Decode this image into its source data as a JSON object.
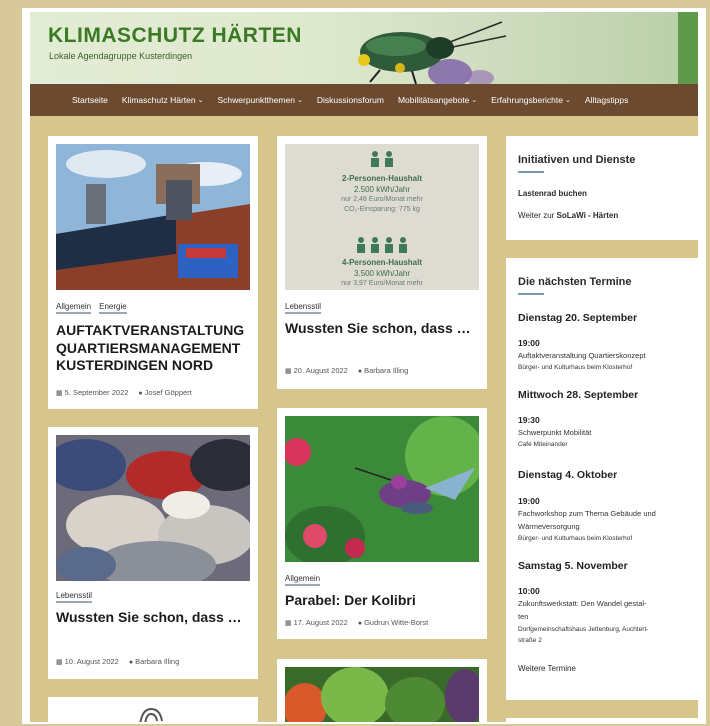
{
  "site": {
    "title": "KLIMASCHUTZ HÄRTEN",
    "subtitle": "Lokale Agendagruppe Kusterdingen"
  },
  "nav": [
    {
      "label": "Startseite",
      "dropdown": false
    },
    {
      "label": "Klimaschutz Härten",
      "dropdown": true
    },
    {
      "label": "Schwerpunktthemen",
      "dropdown": true
    },
    {
      "label": "Diskussionsforum",
      "dropdown": false
    },
    {
      "label": "Mobilitätsangebote",
      "dropdown": true
    },
    {
      "label": "Erfahrungsberichte",
      "dropdown": true
    },
    {
      "label": "Alltagstipps",
      "dropdown": false
    }
  ],
  "posts": [
    {
      "categories": [
        "Allgemein",
        "Energie"
      ],
      "title": "AUFTAKTVERANSTALTUNG QUARTIERSMANAGEMENT KUSTERDINGEN NORD",
      "date": "5. September 2022",
      "author": "Josef Göppert"
    },
    {
      "categories": [
        "Lebensstil"
      ],
      "title": "Wussten Sie schon, dass …",
      "date": "20. August 2022",
      "author": "Barbara Illing",
      "image_text": {
        "household2_title": "2-Personen-Haushalt",
        "household2_kwh": "2.500 kWh/Jahr",
        "household2_cost": "nur 2,48 Euro/Monat mehr",
        "household2_co2": "CO₂-Einsparung: 775 kg",
        "household4_title": "4-Personen-Haushalt",
        "household4_kwh": "3.500 kWh/Jahr",
        "household4_cost": "nur 3,97 Euro/Monat mehr"
      }
    },
    {
      "categories": [
        "Lebensstil"
      ],
      "title": "Wussten Sie schon, dass …",
      "date": "10. August 2022",
      "author": "Barbara Illing"
    },
    {
      "categories": [
        "Allgemein"
      ],
      "title": "Parabel: Der Kolibri",
      "date": "17. August 2022",
      "author": "Gudrun Witte-Borst"
    }
  ],
  "sidebar": {
    "initiatives": {
      "heading": "Initiativen und Dienste",
      "link1": "Lastenrad buchen",
      "link2_prefix": "Weiter zur ",
      "link2_bold": "SoLaWi - Härten"
    },
    "events": {
      "heading": "Die nächsten Termine",
      "items": [
        {
          "day": "Dienstag 20. September",
          "time": "19:00",
          "title": "Auftaktveranstaltung Quartierskonzept",
          "location": "Bürger- und Kulturhaus beim Klosterhof"
        },
        {
          "day": "Mittwoch 28. September",
          "time": "19:30",
          "title": "Schwerpunkt Mobilität",
          "location": "Café Miteinander"
        },
        {
          "day": "Dienstag 4. Oktober",
          "time": "19:00",
          "title": "Fachworkshop zum Thema Gebäude und",
          "title2": "Wärmeversorgung",
          "location": "Bürger- und Kulturhaus beim Klosterhof"
        },
        {
          "day": "Samstag 5. November",
          "time": "10:00",
          "title": "Zukunftswerkstatt: Den Wandel gestal-",
          "title2": "ten",
          "location": "Dorfgemeinschaftshaus Jettenburg, Auchtert-",
          "location2": "straße 2"
        }
      ],
      "more": "Weitere Termine"
    }
  },
  "colors": {
    "nav_bg": "#6b4a2f",
    "title_green": "#3a7a25",
    "page_bg": "#d7c58e"
  }
}
